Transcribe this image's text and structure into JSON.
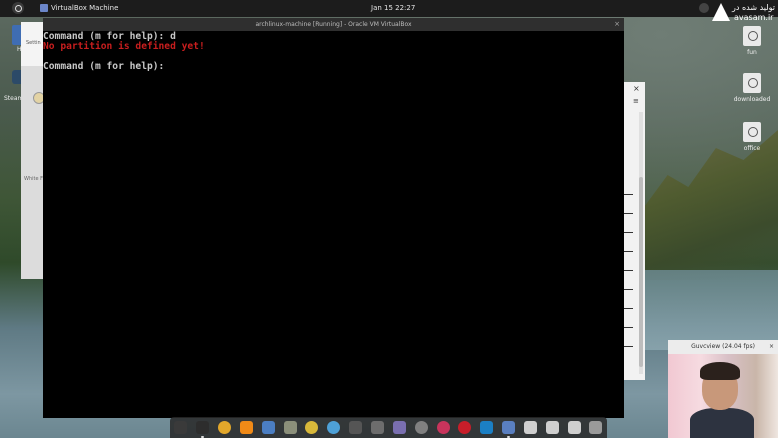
{
  "top_panel": {
    "app_name": "VirtualBox Machine",
    "clock": "Jan 15  22:27"
  },
  "watermark": {
    "line1": "تولید شده در",
    "line2": "avasam.ir"
  },
  "desktop_icons_right": [
    {
      "label": "fun"
    },
    {
      "label": "downloaded"
    },
    {
      "label": "office"
    }
  ],
  "desktop_icons_left": {
    "h_label": "H",
    "steam_label": "Steam"
  },
  "settings_window": {
    "title_fragment": "Settin",
    "white_fragment": "White F"
  },
  "side_window": {
    "close": "×",
    "menu": "≡"
  },
  "vm_window": {
    "title": "archlinux-machine [Running] - Oracle VM VirtualBox",
    "close": "×",
    "terminal_lines": [
      {
        "text": "Command (m for help): d",
        "color": "normal"
      },
      {
        "text": "No partition is defined yet!",
        "color": "red"
      },
      {
        "text": "",
        "color": "normal"
      },
      {
        "text": "Command (m for help):",
        "color": "normal"
      }
    ]
  },
  "webcam": {
    "title": "Guvcview  (24.04 fps)",
    "close": "×"
  },
  "dock_items": [
    {
      "icon": "app-grid-icon",
      "color": "#3a3a3a",
      "dot": false
    },
    {
      "icon": "terminal-icon",
      "color": "#2d2d2d",
      "dot": true
    },
    {
      "icon": "chrome-icon",
      "color": "#e2a72b",
      "dot": false
    },
    {
      "icon": "vlc-icon",
      "color": "#f08a17",
      "dot": false
    },
    {
      "icon": "headphones-icon",
      "color": "#4b7ec2",
      "dot": false
    },
    {
      "icon": "files-icon",
      "color": "#8b8f7a",
      "dot": false
    },
    {
      "icon": "disc-icon",
      "color": "#d8b83a",
      "dot": false
    },
    {
      "icon": "color-wheel-icon",
      "color": "#4ea1d8",
      "dot": false
    },
    {
      "icon": "game-icon",
      "color": "#555555",
      "dot": false
    },
    {
      "icon": "inkscape-icon",
      "color": "#6d6d6d",
      "dot": false
    },
    {
      "icon": "network-icon",
      "color": "#7a6fb0",
      "dot": false
    },
    {
      "icon": "settings-icon",
      "color": "#808080",
      "dot": false
    },
    {
      "icon": "record-icon",
      "color": "#c8345c",
      "dot": false
    },
    {
      "icon": "opera-icon",
      "color": "#c81e2a",
      "dot": false
    },
    {
      "icon": "vscode-icon",
      "color": "#1b7fc4",
      "dot": false
    },
    {
      "icon": "virtualbox-icon",
      "color": "#5a7fc0",
      "dot": true
    },
    {
      "icon": "drive-icon",
      "color": "#cfcfcf",
      "dot": false
    },
    {
      "icon": "drive-icon",
      "color": "#cfcfcf",
      "dot": false
    },
    {
      "icon": "drive-icon",
      "color": "#cfcfcf",
      "dot": false
    },
    {
      "icon": "trash-icon",
      "color": "#9a9a9a",
      "dot": false
    }
  ]
}
